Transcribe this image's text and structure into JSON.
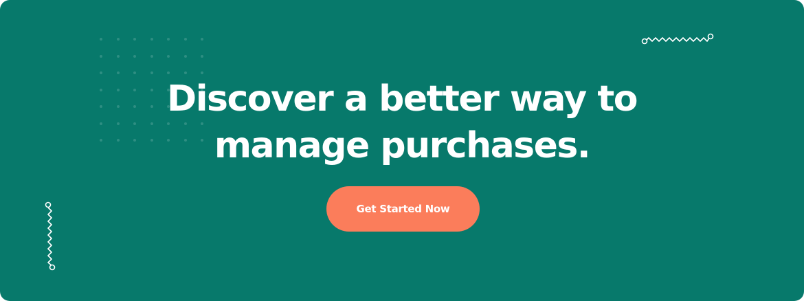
{
  "headline": {
    "line1": "Discover a better way to",
    "line2": "manage purchases."
  },
  "cta": {
    "label": "Get Started Now"
  },
  "colors": {
    "background": "#07796b",
    "button": "#fb7d5b",
    "text": "#ffffff"
  },
  "decorations": {
    "dot_grid_icon": "dot-grid-pattern",
    "top_right_icon": "zigzag-line-icon",
    "bottom_left_icon": "zigzag-line-icon"
  }
}
